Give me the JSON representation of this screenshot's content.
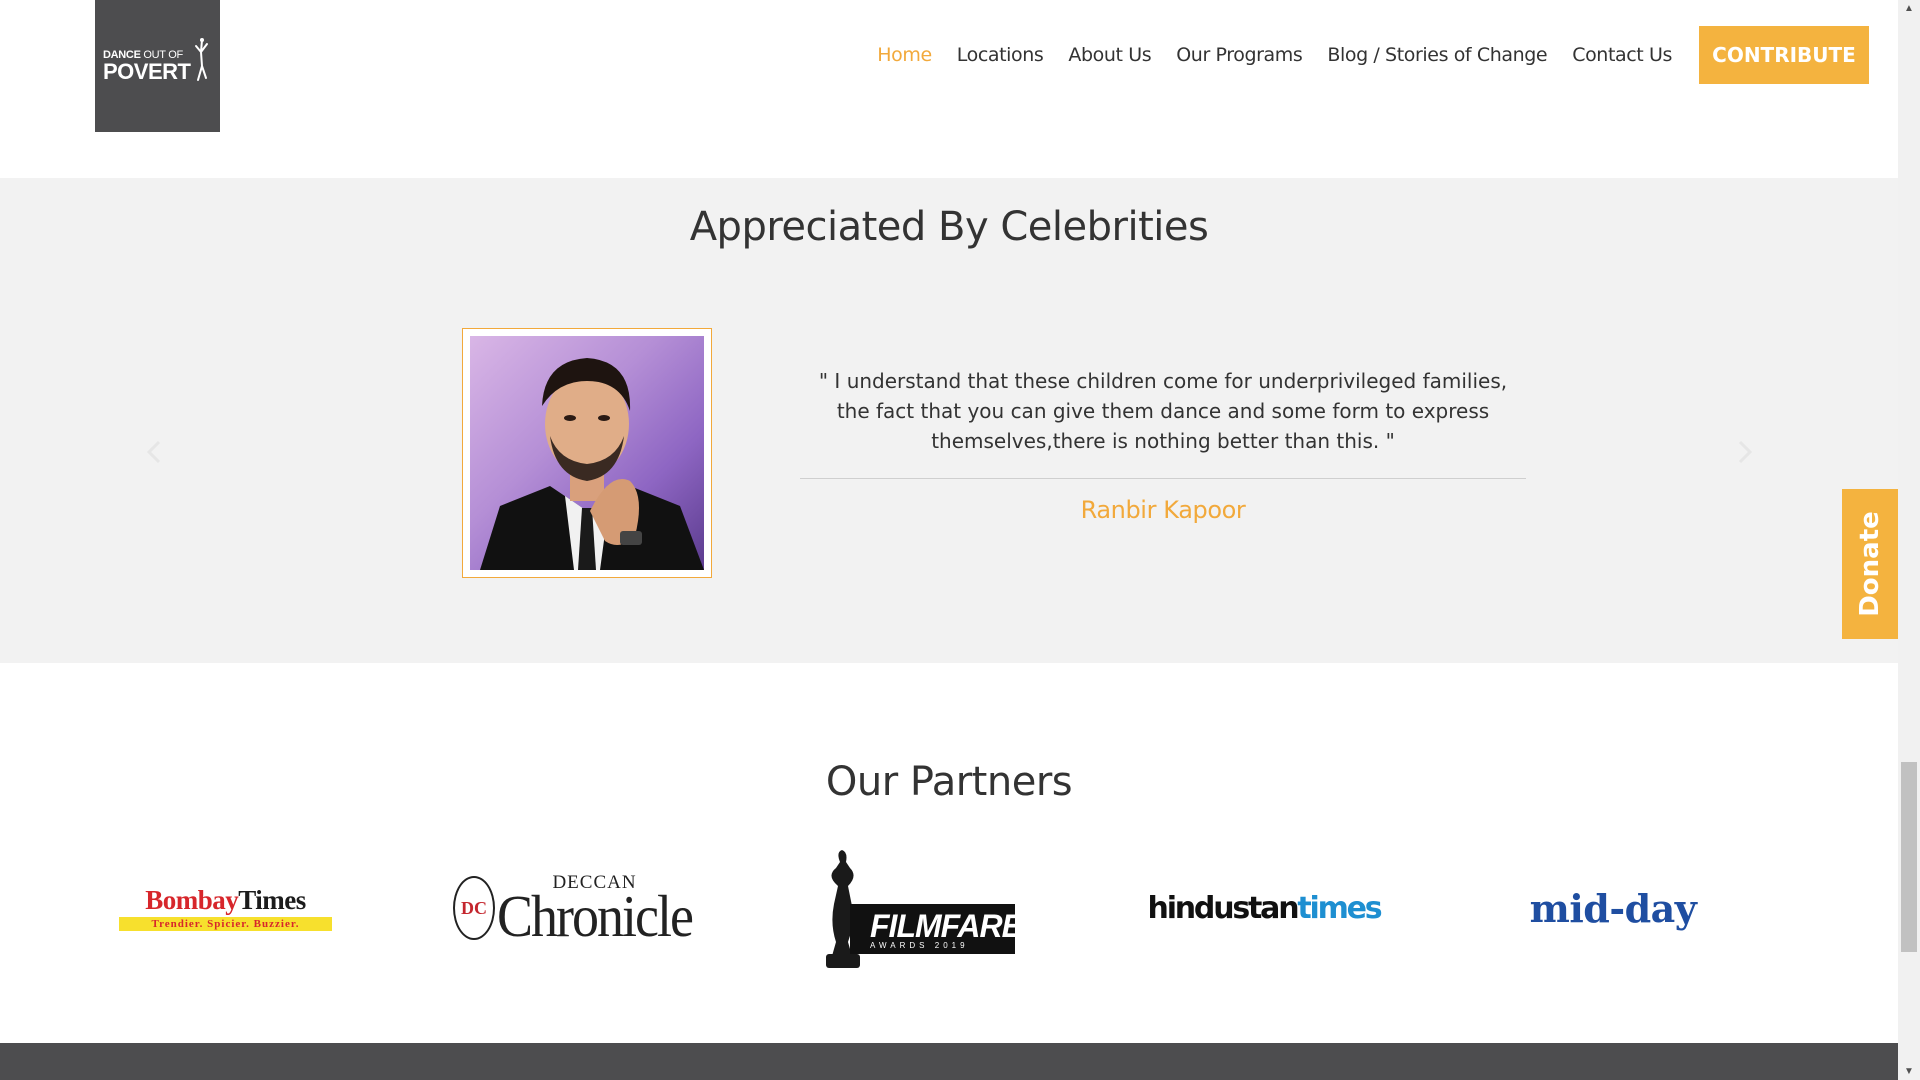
{
  "header": {
    "logo_line1_bold": "DANCE",
    "logo_line1_thin": " OUT OF",
    "logo_line2": "POVERT",
    "nav": [
      {
        "label": "Home",
        "active": true
      },
      {
        "label": "Locations"
      },
      {
        "label": "About Us"
      },
      {
        "label": "Our Programs"
      },
      {
        "label": "Blog / Stories of Change"
      },
      {
        "label": "Contact Us"
      }
    ],
    "contribute_label": "CONTRIBUTE"
  },
  "celebrities": {
    "title": "Appreciated By Celebrities",
    "quote": "\" I understand that these children come for underprivileged families, the fact that you can give them dance and some form to express themselves,there is nothing better than this. \"",
    "author": "Ranbir Kapoor",
    "prev_icon": "chevron-left-icon",
    "next_icon": "chevron-right-icon"
  },
  "donate_label": "Donate",
  "partners": {
    "title": "Our Partners",
    "bombay_times": {
      "bold1": "Bombay",
      "bold2": "Times",
      "tagline": "Trendier. Spicier. Buzzier."
    },
    "deccan_chronicle": {
      "emblem": "DC",
      "top": "DECCAN",
      "main": "Chronicle"
    },
    "filmfare": {
      "main": "FILMFARE",
      "sub": "AWARDS 2019"
    },
    "hindustan_times": {
      "part1": "hindustan",
      "part2": "times"
    },
    "mid_day": {
      "text": "mid-day"
    }
  },
  "colors": {
    "accent": "#f4b33f",
    "active_nav": "#f2a93b",
    "section_bg": "#f2f2f2",
    "logo_bg": "#4d4d4f"
  }
}
